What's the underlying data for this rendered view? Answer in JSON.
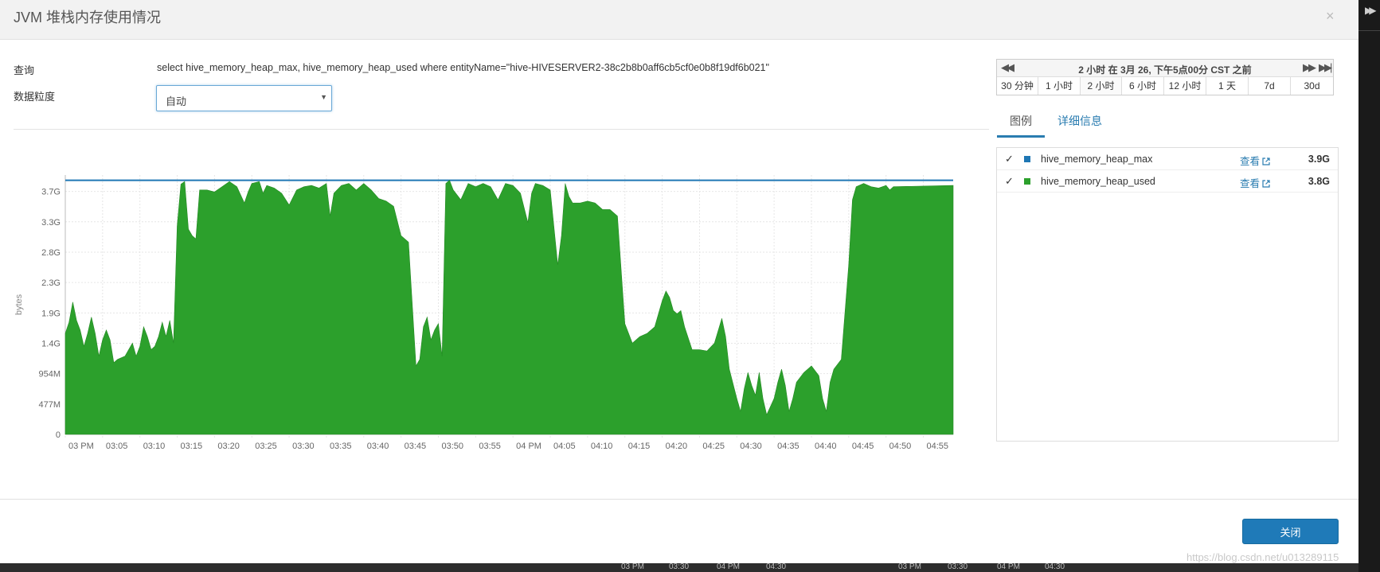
{
  "modal": {
    "title": "JVM 堆栈内存使用情况",
    "close_glyph": "×"
  },
  "query": {
    "label": "查询",
    "text": "select hive_memory_heap_max, hive_memory_heap_used where entityName=\"hive-HIVESERVER2-38c2b8b0aff6cb5cf0e0b8f19df6b021\""
  },
  "granularity": {
    "label": "数据粒度",
    "selected": "自动"
  },
  "time_range": {
    "label": "2 小时 在 3月 26, 下午5点00分 CST 之前",
    "buttons": [
      "30 分钟",
      "1 小时",
      "2 小时",
      "6 小时",
      "12 小时",
      "1 天",
      "7d",
      "30d"
    ],
    "active": "2 小时"
  },
  "tabs": {
    "legend": "图例",
    "details": "详细信息"
  },
  "legend": {
    "view_label": "查看",
    "check_glyph": "✓",
    "items": [
      {
        "name": "hive_memory_heap_max",
        "value": "3.9G",
        "color": "#1f77b4"
      },
      {
        "name": "hive_memory_heap_used",
        "value": "3.8G",
        "color": "#2ca02c"
      }
    ]
  },
  "footer": {
    "close_label": "关闭"
  },
  "watermark": "https://blog.csdn.net/u013289115",
  "backdrop": {
    "bottom_ticks": [
      "03 PM",
      "03:30",
      "04 PM",
      "04:30",
      "03 PM",
      "03:30",
      "04 PM",
      "04:30"
    ]
  },
  "chart_data": {
    "type": "area",
    "ylabel": "bytes",
    "y_unit": "GB",
    "ylim": [
      0,
      3.98
    ],
    "yticks": [
      {
        "label": "0",
        "value": 0
      },
      {
        "label": "477M",
        "value": 0.466
      },
      {
        "label": "954M",
        "value": 0.932
      },
      {
        "label": "1.4G",
        "value": 1.398
      },
      {
        "label": "1.9G",
        "value": 1.864
      },
      {
        "label": "2.3G",
        "value": 2.33
      },
      {
        "label": "2.8G",
        "value": 2.796
      },
      {
        "label": "3.3G",
        "value": 3.262
      },
      {
        "label": "3.7G",
        "value": 3.728
      }
    ],
    "x_start": "03:00",
    "x_end": "04:59",
    "xticks": [
      "03 PM",
      "03:05",
      "03:10",
      "03:15",
      "03:20",
      "03:25",
      "03:30",
      "03:35",
      "03:40",
      "03:45",
      "03:50",
      "03:55",
      "04 PM",
      "04:05",
      "04:10",
      "04:15",
      "04:20",
      "04:25",
      "04:30",
      "04:35",
      "04:40",
      "04:45",
      "04:50",
      "04:55"
    ],
    "grid": true,
    "series": [
      {
        "name": "hive_memory_heap_max",
        "style": "line",
        "color": "#1f77b4",
        "points": [
          [
            "03:00",
            3.9
          ],
          [
            "04:59",
            3.9
          ]
        ]
      },
      {
        "name": "hive_memory_heap_used",
        "style": "area",
        "color": "#2ca02c",
        "points": [
          [
            "03:00",
            1.55
          ],
          [
            "03:00:30",
            1.72
          ],
          [
            "03:01",
            2.03
          ],
          [
            "03:01:30",
            1.75
          ],
          [
            "03:02",
            1.6
          ],
          [
            "03:02:30",
            1.35
          ],
          [
            "03:03",
            1.55
          ],
          [
            "03:03:30",
            1.8
          ],
          [
            "03:04",
            1.55
          ],
          [
            "03:04:30",
            1.2
          ],
          [
            "03:05",
            1.45
          ],
          [
            "03:05:30",
            1.6
          ],
          [
            "03:06",
            1.45
          ],
          [
            "03:06:30",
            1.1
          ],
          [
            "03:07",
            1.15
          ],
          [
            "03:08",
            1.2
          ],
          [
            "03:08:30",
            1.3
          ],
          [
            "03:09",
            1.4
          ],
          [
            "03:09:30",
            1.2
          ],
          [
            "03:10",
            1.35
          ],
          [
            "03:10:30",
            1.65
          ],
          [
            "03:11",
            1.5
          ],
          [
            "03:11:30",
            1.3
          ],
          [
            "03:12",
            1.35
          ],
          [
            "03:12:30",
            1.5
          ],
          [
            "03:13",
            1.72
          ],
          [
            "03:13:30",
            1.5
          ],
          [
            "03:14",
            1.75
          ],
          [
            "03:14:30",
            1.4
          ],
          [
            "03:15",
            3.2
          ],
          [
            "03:15:30",
            3.84
          ],
          [
            "03:16",
            3.88
          ],
          [
            "03:16:30",
            3.15
          ],
          [
            "03:17",
            3.05
          ],
          [
            "03:17:30",
            3.0
          ],
          [
            "03:18",
            3.75
          ],
          [
            "03:19",
            3.75
          ],
          [
            "03:20",
            3.72
          ],
          [
            "03:21",
            3.8
          ],
          [
            "03:22",
            3.88
          ],
          [
            "03:23",
            3.8
          ],
          [
            "03:24",
            3.55
          ],
          [
            "03:24:30",
            3.72
          ],
          [
            "03:25",
            3.85
          ],
          [
            "03:26",
            3.88
          ],
          [
            "03:26:30",
            3.7
          ],
          [
            "03:27",
            3.82
          ],
          [
            "03:28",
            3.78
          ],
          [
            "03:29",
            3.7
          ],
          [
            "03:30",
            3.52
          ],
          [
            "03:31",
            3.75
          ],
          [
            "03:32",
            3.8
          ],
          [
            "03:33",
            3.82
          ],
          [
            "03:34",
            3.78
          ],
          [
            "03:35",
            3.85
          ],
          [
            "03:35:30",
            3.35
          ],
          [
            "03:36",
            3.7
          ],
          [
            "03:37",
            3.82
          ],
          [
            "03:38",
            3.85
          ],
          [
            "03:39",
            3.75
          ],
          [
            "03:40",
            3.85
          ],
          [
            "03:41",
            3.75
          ],
          [
            "03:42",
            3.62
          ],
          [
            "03:43",
            3.58
          ],
          [
            "03:44",
            3.5
          ],
          [
            "03:45",
            3.05
          ],
          [
            "03:46",
            2.95
          ],
          [
            "03:47",
            1.05
          ],
          [
            "03:47:30",
            1.15
          ],
          [
            "03:48",
            1.65
          ],
          [
            "03:48:30",
            1.8
          ],
          [
            "03:49",
            1.45
          ],
          [
            "03:49:30",
            1.6
          ],
          [
            "03:50",
            1.7
          ],
          [
            "03:50:30",
            1.2
          ],
          [
            "03:51",
            3.85
          ],
          [
            "03:51:30",
            3.9
          ],
          [
            "03:52",
            3.75
          ],
          [
            "03:53",
            3.6
          ],
          [
            "03:54",
            3.85
          ],
          [
            "03:55",
            3.8
          ],
          [
            "03:56",
            3.85
          ],
          [
            "03:57",
            3.8
          ],
          [
            "03:58",
            3.6
          ],
          [
            "03:59",
            3.85
          ],
          [
            "04:00",
            3.82
          ],
          [
            "04:01",
            3.7
          ],
          [
            "04:02",
            3.25
          ],
          [
            "04:02:30",
            3.7
          ],
          [
            "04:03",
            3.85
          ],
          [
            "04:04",
            3.82
          ],
          [
            "04:05",
            3.75
          ],
          [
            "04:06",
            2.6
          ],
          [
            "04:06:30",
            3.05
          ],
          [
            "04:07",
            3.85
          ],
          [
            "04:07:30",
            3.65
          ],
          [
            "04:08",
            3.55
          ],
          [
            "04:09",
            3.55
          ],
          [
            "04:10",
            3.58
          ],
          [
            "04:11",
            3.55
          ],
          [
            "04:12",
            3.45
          ],
          [
            "04:13",
            3.45
          ],
          [
            "04:14",
            3.35
          ],
          [
            "04:15",
            1.7
          ],
          [
            "04:16",
            1.4
          ],
          [
            "04:17",
            1.5
          ],
          [
            "04:18",
            1.55
          ],
          [
            "04:19",
            1.65
          ],
          [
            "04:20",
            2.05
          ],
          [
            "04:20:30",
            2.2
          ],
          [
            "04:21",
            2.1
          ],
          [
            "04:21:30",
            1.9
          ],
          [
            "04:22",
            1.85
          ],
          [
            "04:22:30",
            1.9
          ],
          [
            "04:23",
            1.65
          ],
          [
            "04:24",
            1.3
          ],
          [
            "04:25",
            1.3
          ],
          [
            "04:26",
            1.28
          ],
          [
            "04:27",
            1.4
          ],
          [
            "04:28",
            1.78
          ],
          [
            "04:28:30",
            1.5
          ],
          [
            "04:29",
            1.0
          ],
          [
            "04:30",
            0.55
          ],
          [
            "04:30:30",
            0.35
          ],
          [
            "04:31",
            0.7
          ],
          [
            "04:31:30",
            0.95
          ],
          [
            "04:32",
            0.75
          ],
          [
            "04:32:30",
            0.6
          ],
          [
            "04:33",
            0.95
          ],
          [
            "04:33:30",
            0.55
          ],
          [
            "04:34",
            0.3
          ],
          [
            "04:35",
            0.55
          ],
          [
            "04:35:30",
            0.8
          ],
          [
            "04:36",
            1.0
          ],
          [
            "04:36:30",
            0.75
          ],
          [
            "04:37",
            0.35
          ],
          [
            "04:37:30",
            0.55
          ],
          [
            "04:38",
            0.8
          ],
          [
            "04:39",
            0.95
          ],
          [
            "04:40",
            1.05
          ],
          [
            "04:41",
            0.9
          ],
          [
            "04:41:30",
            0.55
          ],
          [
            "04:42",
            0.35
          ],
          [
            "04:42:30",
            0.8
          ],
          [
            "04:43",
            1.0
          ],
          [
            "04:44",
            1.15
          ],
          [
            "04:45",
            2.6
          ],
          [
            "04:45:30",
            3.6
          ],
          [
            "04:46",
            3.8
          ],
          [
            "04:47",
            3.85
          ],
          [
            "04:48",
            3.8
          ],
          [
            "04:49",
            3.78
          ],
          [
            "04:50",
            3.82
          ],
          [
            "04:50:30",
            3.75
          ],
          [
            "04:51",
            3.8
          ],
          [
            "04:59",
            3.82
          ]
        ]
      }
    ]
  }
}
